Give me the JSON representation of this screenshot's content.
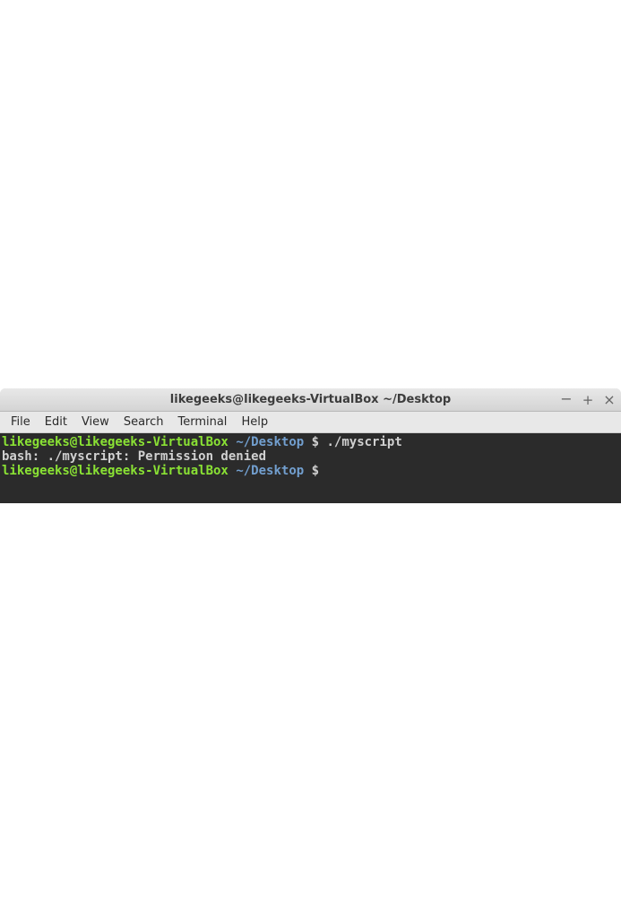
{
  "window": {
    "title": "likegeeks@likegeeks-VirtualBox ~/Desktop"
  },
  "menubar": {
    "items": [
      "File",
      "Edit",
      "View",
      "Search",
      "Terminal",
      "Help"
    ]
  },
  "terminal": {
    "lines": [
      {
        "user_host": "likegeeks@likegeeks-VirtualBox",
        "path": "~/Desktop",
        "symbol": "$",
        "command": "./myscript"
      },
      {
        "output": "bash: ./myscript: Permission denied"
      },
      {
        "user_host": "likegeeks@likegeeks-VirtualBox",
        "path": "~/Desktop",
        "symbol": "$",
        "command": ""
      }
    ]
  }
}
